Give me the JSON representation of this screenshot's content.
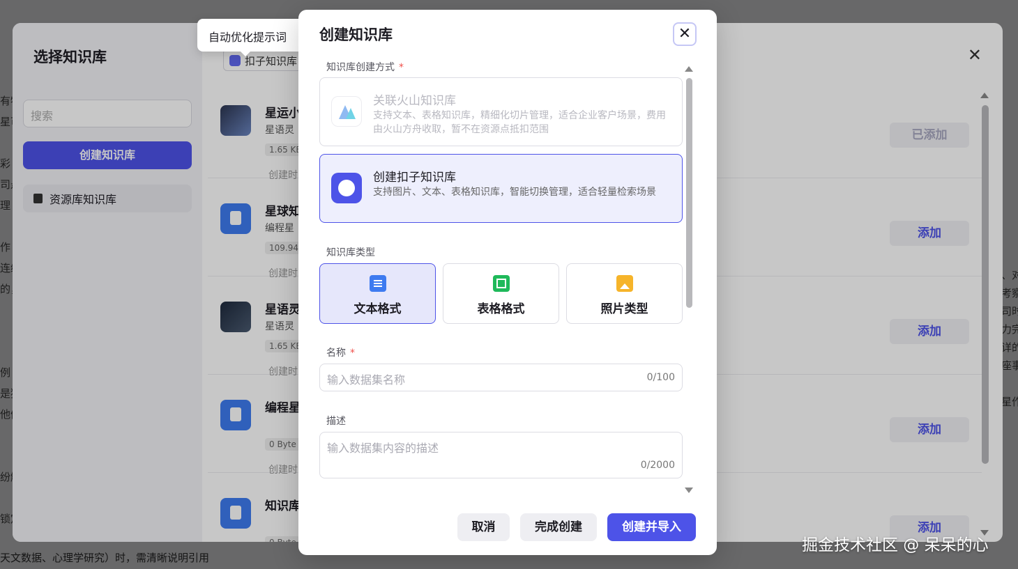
{
  "background": {
    "left_text": [
      "有特",
      "星可",
      "",
      "彩",
      "司悬",
      "理",
      "",
      "作",
      "连续",
      "的，",
      "",
      "",
      "",
      "例",
      "是独",
      "他们",
      "",
      "",
      "纷解",
      "",
      "锁定"
    ],
    "right_text": [
      "、对",
      "考察",
      "司时",
      "力完",
      "详的",
      "座事",
      "",
      "星作"
    ],
    "bottom_text": "天文数据、心理学研究）时，需清晰说明引用"
  },
  "outer_dialog": {
    "title": "选择知识库",
    "search_placeholder": "搜索",
    "create_button": "创建知识库",
    "resource_item": "资源库知识库",
    "selected_tag": "扣子知识库",
    "rows": [
      {
        "title": "星运小",
        "subtitle": "星语灵",
        "size": "1.65 KB",
        "time": "创建时",
        "action": "已添加",
        "thumb": "img1"
      },
      {
        "title": "星球知",
        "subtitle": "编程星",
        "size": "109.94",
        "time": "创建时",
        "action": "添加",
        "thumb": "doc"
      },
      {
        "title": "星语灵",
        "subtitle": "星语灵",
        "size": "1.65 KB",
        "time": "创建时",
        "action": "添加",
        "thumb": "img2"
      },
      {
        "title": "编程星",
        "subtitle": "",
        "size": "0 Byte",
        "time": "创建时",
        "action": "添加",
        "thumb": "doc"
      },
      {
        "title": "知识库",
        "subtitle": "",
        "size": "0 Byte",
        "time": "",
        "action": "添加",
        "thumb": "doc"
      }
    ]
  },
  "tooltip": "自动优化提示词",
  "modal": {
    "title": "创建知识库",
    "method_label": "知识库创建方式",
    "required_mark": "*",
    "options": [
      {
        "title": "关联火山知识库",
        "desc": "支持文本、表格知识库，精细化切片管理，适合企业客户场景，费用由火山方舟收取，暂不在资源点抵扣范围",
        "state": "disabled",
        "icon": "volcano-icon"
      },
      {
        "title": "创建扣子知识库",
        "desc": "支持图片、文本、表格知识库，智能切换管理，适合轻量检索场景",
        "state": "selected",
        "icon": "coze-icon"
      }
    ],
    "type_label": "知识库类型",
    "types": [
      {
        "label": "文本格式",
        "icon": "doc-icon",
        "selected": true
      },
      {
        "label": "表格格式",
        "icon": "table-icon",
        "selected": false
      },
      {
        "label": "照片类型",
        "icon": "image-icon",
        "selected": false
      }
    ],
    "name_label": "名称",
    "name_placeholder": "输入数据集名称",
    "name_count": "0/100",
    "desc_label": "描述",
    "desc_placeholder": "输入数据集内容的描述",
    "desc_count": "0/2000",
    "buttons": {
      "cancel": "取消",
      "finish": "完成创建",
      "create_import": "创建并导入"
    }
  },
  "watermark": "掘金技术社区 @ 呆呆的心",
  "colors": {
    "primary": "#4d53e8",
    "required": "#f0504b"
  }
}
